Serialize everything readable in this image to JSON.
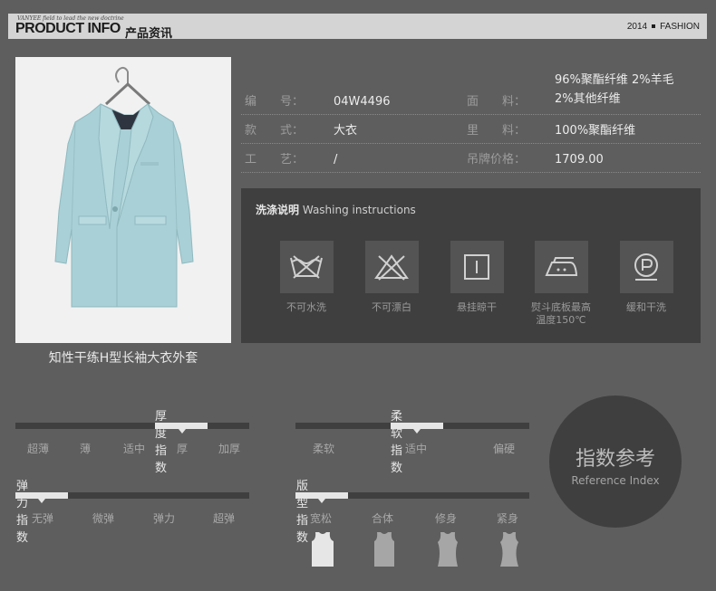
{
  "header": {
    "tagline": "VANYEE field to lead the new doctrine",
    "title_en": "PRODUCT INFO",
    "title_cn": "产品资讯",
    "year": "2014",
    "category": "FASHION"
  },
  "product": {
    "caption": "知性干练H型长袖大衣外套",
    "image_name": "light-blue-wool-coat"
  },
  "info": {
    "code_label": "编　　号：",
    "code_value": "04W4496",
    "fabric_label": "面　　料：",
    "fabric_value_1": "96%聚酯纤维 2%羊毛",
    "fabric_value_2": "2%其他纤维",
    "style_label": "款　　式：",
    "style_value": "大衣",
    "lining_label": "里　　料：",
    "lining_value": "100%聚酯纤维",
    "craft_label": "工　　艺：",
    "craft_value": "/",
    "price_label": "吊牌价格：",
    "price_value": "1709.00"
  },
  "washing": {
    "title_cn": "洗涤说明",
    "title_en": "Washing instructions",
    "items": [
      {
        "icon": "no-wash-icon",
        "label": "不可水洗"
      },
      {
        "icon": "no-bleach-icon",
        "label": "不可漂白"
      },
      {
        "icon": "hang-dry-icon",
        "label": "悬挂晾干"
      },
      {
        "icon": "iron-medium-icon",
        "label_1": "熨斗底板最高",
        "label_2": "温度150℃"
      },
      {
        "icon": "dry-clean-p-icon",
        "label": "缓和干洗"
      }
    ]
  },
  "indices": {
    "thickness": {
      "title": "厚度指数",
      "options": [
        "超薄",
        "薄",
        "适中",
        "厚",
        "加厚"
      ],
      "selected_index": 3
    },
    "softness": {
      "title": "柔软指数",
      "options": [
        "柔软",
        "适中",
        "偏硬"
      ],
      "selected_index": 1
    },
    "elasticity": {
      "title": "弹力指数",
      "options": [
        "无弹",
        "微弹",
        "弹力",
        "超弹"
      ],
      "selected_index": 0
    },
    "fit": {
      "title": "版型指数",
      "options": [
        "宽松",
        "合体",
        "修身",
        "紧身"
      ],
      "selected_index": 0
    }
  },
  "reference": {
    "title_cn": "指数参考",
    "title_en": "Reference Index"
  },
  "colors": {
    "background": "#5e5e5e",
    "panel": "#3f3f3f",
    "highlight": "#e6e6e6"
  }
}
